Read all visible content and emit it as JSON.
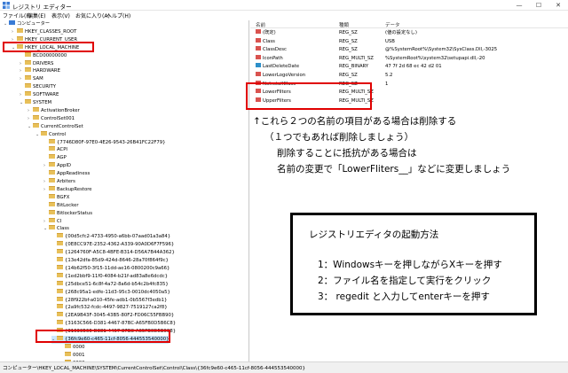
{
  "window": {
    "title": "レジストリ エディター",
    "minimize_glyph": "—",
    "maximize_glyph": "☐",
    "close_glyph": "✕"
  },
  "menu": [
    "ファイル(F)",
    "編集(E)",
    "表示(V)",
    "お気に入り(A)",
    "ヘルプ(H)"
  ],
  "tree": {
    "rows": [
      {
        "text": "コンピューター",
        "indent": 0,
        "tw": "⌄",
        "icon": "pc"
      },
      {
        "text": "HKEY_CLASSES_ROOT",
        "indent": 1,
        "tw": "›",
        "icon": "folder"
      },
      {
        "text": "HKEY_CURRENT_USER",
        "indent": 1,
        "tw": "›",
        "icon": "folder"
      },
      {
        "text": "HKEY_LOCAL_MACHINE",
        "indent": 1,
        "tw": "⌄",
        "icon": "folder"
      },
      {
        "text": "BCD00000000",
        "indent": 2,
        "tw": "",
        "icon": "folder"
      },
      {
        "text": "DRIVERS",
        "indent": 2,
        "tw": "›",
        "icon": "folder"
      },
      {
        "text": "HARDWARE",
        "indent": 2,
        "tw": "›",
        "icon": "folder"
      },
      {
        "text": "SAM",
        "indent": 2,
        "tw": "›",
        "icon": "folder"
      },
      {
        "text": "SECURITY",
        "indent": 2,
        "tw": "",
        "icon": "folder"
      },
      {
        "text": "SOFTWARE",
        "indent": 2,
        "tw": "›",
        "icon": "folder"
      },
      {
        "text": "SYSTEM",
        "indent": 2,
        "tw": "⌄",
        "icon": "folder"
      },
      {
        "text": "ActivationBroker",
        "indent": 3,
        "tw": "›",
        "icon": "folder"
      },
      {
        "text": "ControlSet001",
        "indent": 3,
        "tw": "›",
        "icon": "folder"
      },
      {
        "text": "CurrentControlSet",
        "indent": 3,
        "tw": "⌄",
        "icon": "folder"
      },
      {
        "text": "Control",
        "indent": 4,
        "tw": "⌄",
        "icon": "folder"
      },
      {
        "text": "{7746D80F-97E0-4E26-9543-26B41FC22F79}",
        "indent": 5,
        "tw": "",
        "icon": "folder"
      },
      {
        "text": "ACPI",
        "indent": 5,
        "tw": "",
        "icon": "folder"
      },
      {
        "text": "AGP",
        "indent": 5,
        "tw": "",
        "icon": "folder"
      },
      {
        "text": "AppID",
        "indent": 5,
        "tw": "›",
        "icon": "folder"
      },
      {
        "text": "AppReadiness",
        "indent": 5,
        "tw": "",
        "icon": "folder"
      },
      {
        "text": "Arbiters",
        "indent": 5,
        "tw": "›",
        "icon": "folder"
      },
      {
        "text": "BackupRestore",
        "indent": 5,
        "tw": "›",
        "icon": "folder"
      },
      {
        "text": "BGFX",
        "indent": 5,
        "tw": "",
        "icon": "folder"
      },
      {
        "text": "BitLocker",
        "indent": 5,
        "tw": "",
        "icon": "folder"
      },
      {
        "text": "BitlockerStatus",
        "indent": 5,
        "tw": "",
        "icon": "folder"
      },
      {
        "text": "CI",
        "indent": 5,
        "tw": "›",
        "icon": "folder"
      },
      {
        "text": "Class",
        "indent": 5,
        "tw": "⌄",
        "icon": "folder"
      },
      {
        "text": "{00d5cfc2-4733-4950-a6bb-07aad01a3a84}",
        "indent": 6,
        "tw": "",
        "icon": "folder"
      },
      {
        "text": "{0E8CC97E-2352-4362-A339-90A0D6F7F596}",
        "indent": 6,
        "tw": "",
        "icon": "folder"
      },
      {
        "text": "{1264760F-A5C8-4BFE-B314-D56A7B44A362}",
        "indent": 6,
        "tw": "",
        "icon": "folder"
      },
      {
        "text": "{13e42dfa-85d9-424d-8646-28a70f864f9c}",
        "indent": 6,
        "tw": "",
        "icon": "folder"
      },
      {
        "text": "{14b62f50-3f15-11dd-ae16-0800200c9a66}",
        "indent": 6,
        "tw": "",
        "icon": "folder"
      },
      {
        "text": "{1ed2bbf9-11f0-4084-b21f-ad83a8e6dcdc}",
        "indent": 6,
        "tw": "",
        "icon": "folder"
      },
      {
        "text": "{25dbce51-6c8f-4a72-8a6d-b54c2b4fc835}",
        "indent": 6,
        "tw": "",
        "icon": "folder"
      },
      {
        "text": "{268c95a1-edfe-11d3-95c3-0010dc4050a5}",
        "indent": 6,
        "tw": "",
        "icon": "folder"
      },
      {
        "text": "{28f922bf-a010-45fe-adb1-0b5567f3edb1}",
        "indent": 6,
        "tw": "",
        "icon": "folder"
      },
      {
        "text": "{2a9fc532-fcdc-4497-9827-7519127ca2f8}",
        "indent": 6,
        "tw": "",
        "icon": "folder"
      },
      {
        "text": "{2EA9B43F-3045-43B5-80F2-FD06C55FBB90}",
        "indent": 6,
        "tw": "",
        "icon": "folder"
      },
      {
        "text": "{3163C566-D381-4467-87BC-A65FB0D5B6C8}",
        "indent": 6,
        "tw": "",
        "icon": "folder"
      },
      {
        "text": "{3163C566-D381-4467-87BC-A65FB0D5B6C8}",
        "indent": 6,
        "tw": "",
        "icon": "folder"
      },
      {
        "text": "{36fc9e60-c465-11cf-8056-444553540000}",
        "indent": 6,
        "tw": "⌄",
        "icon": "folder",
        "selected": true
      },
      {
        "text": "0000",
        "indent": 7,
        "tw": "",
        "icon": "folder"
      },
      {
        "text": "0001",
        "indent": 7,
        "tw": "",
        "icon": "folder"
      },
      {
        "text": "0002",
        "indent": 7,
        "tw": "",
        "icon": "folder"
      }
    ]
  },
  "values": {
    "headers": {
      "name": "名前",
      "type": "種類",
      "data": "データ"
    },
    "rows": [
      {
        "name": "(既定)",
        "type": "REG_SZ",
        "data": "(値の設定なし)",
        "icon": "sz"
      },
      {
        "name": "Class",
        "type": "REG_SZ",
        "data": "USB",
        "icon": "sz"
      },
      {
        "name": "ClassDesc",
        "type": "REG_SZ",
        "data": "@%SystemRoot%\\System32\\SysClass.Dll,-3025",
        "icon": "sz"
      },
      {
        "name": "IconPath",
        "type": "REG_MULTI_SZ",
        "data": "%SystemRoot%\\system32\\setupapi.dll,-20",
        "icon": "sz"
      },
      {
        "name": "LastDeleteDate",
        "type": "REG_BINARY",
        "data": "47 7f 2d 68 ec 42 d2 01",
        "icon": "bin"
      },
      {
        "name": "LowerLogoVersion",
        "type": "REG_SZ",
        "data": "5.2",
        "icon": "sz"
      },
      {
        "name": "NoInstallClass",
        "type": "REG_SZ",
        "data": "1",
        "icon": "sz"
      },
      {
        "name": "LowerFilters",
        "type": "REG_MULTI_SZ",
        "data": "",
        "icon": "sz"
      },
      {
        "name": "UpperFilters",
        "type": "REG_MULTI_SZ",
        "data": "",
        "icon": "sz"
      }
    ]
  },
  "annotation": {
    "line1": "↑これら２つの名前の項目がある場合は削除する",
    "line2": "（１つでもあれば削除しましょう）",
    "line3": "削除することに抵抗がある場合は",
    "line4": "名前の変更で「LowerFliters__」などに変更しましょう"
  },
  "howto": {
    "title": "レジストリエディタの起動方法",
    "steps": [
      "1：Windowsキーを押しながらXキーを押す",
      "2：ファイル名を指定して実行をクリック",
      "3： regedit と入力してenterキーを押す"
    ]
  },
  "statusbar": "コンピューター\\HKEY_LOCAL_MACHINE\\SYSTEM\\CurrentControlSet\\Control\\Class\\{36fc9e60-c465-11cf-8056-444553540000}",
  "colors": {
    "highlight": "#e00000",
    "selection": "#cce8ff",
    "folder": "#e8c05a"
  }
}
